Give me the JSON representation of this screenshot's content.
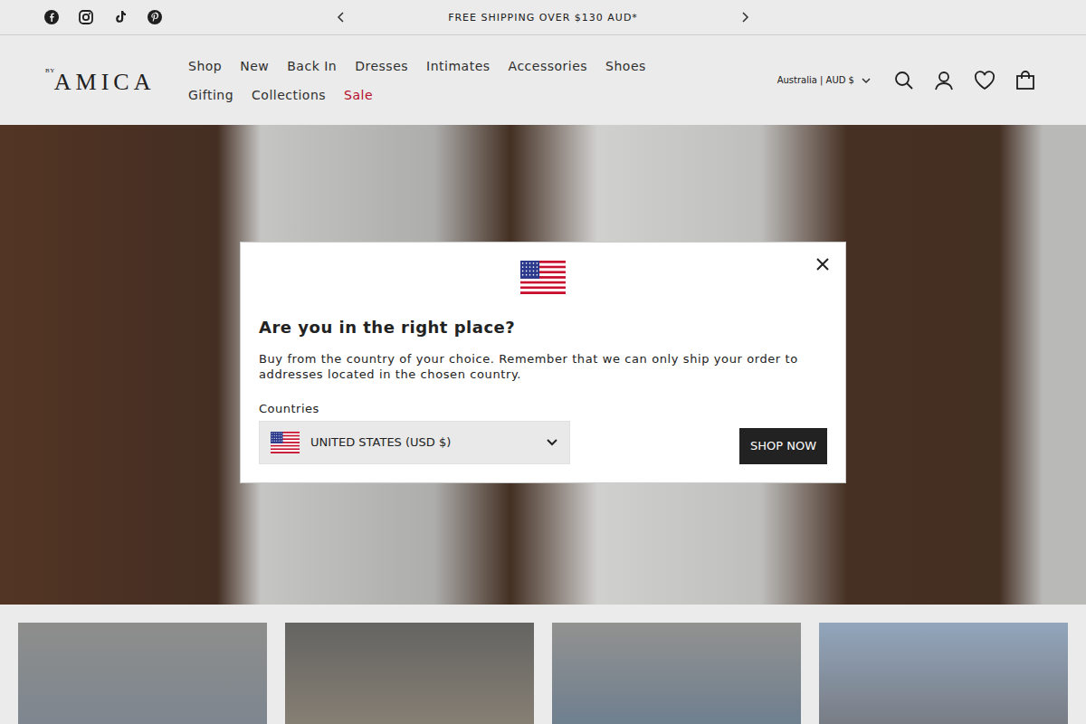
{
  "announcement": {
    "text": "FREE SHIPPING OVER $130 AUD*"
  },
  "logo": {
    "prefix": "BY",
    "name": "AMICA"
  },
  "nav": [
    {
      "label": "Shop",
      "highlight": false
    },
    {
      "label": "New",
      "highlight": false
    },
    {
      "label": "Back In",
      "highlight": false
    },
    {
      "label": "Dresses",
      "highlight": false
    },
    {
      "label": "Intimates",
      "highlight": false
    },
    {
      "label": "Accessories",
      "highlight": false
    },
    {
      "label": "Shoes",
      "highlight": false
    },
    {
      "label": "Gifting",
      "highlight": false
    },
    {
      "label": "Collections",
      "highlight": false
    },
    {
      "label": "Sale",
      "highlight": true
    }
  ],
  "locale": "Australia | AUD $",
  "modal": {
    "title": "Are you in the right place?",
    "message": "Buy from the country of your choice. Remember that we can only ship your order to addresses located in the chosen country.",
    "field_label": "Countries",
    "country": "UNITED STATES (USD $)",
    "button": "SHOP NOW"
  }
}
